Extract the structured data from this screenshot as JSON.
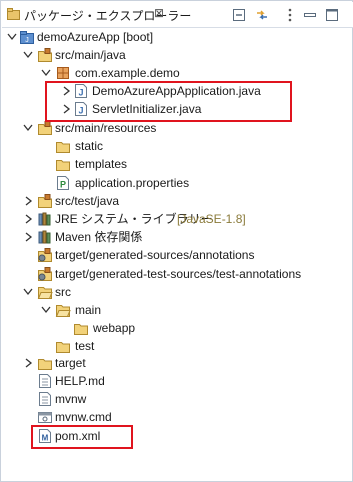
{
  "view": {
    "title": "パッケージ・エクスプローラー",
    "close_glyph": "⊠"
  },
  "tree": [
    {
      "label": "demoAzureApp [boot]"
    },
    {
      "label": "src/main/java"
    },
    {
      "label": "com.example.demo"
    },
    {
      "label": "DemoAzureAppApplication.java"
    },
    {
      "label": "ServletInitializer.java"
    },
    {
      "label": "src/main/resources"
    },
    {
      "label": "static"
    },
    {
      "label": "templates"
    },
    {
      "label": "application.properties"
    },
    {
      "label": "src/test/java"
    },
    {
      "label": "JRE システム・ライブラリー",
      "decoration": "[JavaSE-1.8]"
    },
    {
      "label": "Maven 依存関係"
    },
    {
      "label": "target/generated-sources/annotations"
    },
    {
      "label": "target/generated-test-sources/test-annotations"
    },
    {
      "label": "src"
    },
    {
      "label": "main"
    },
    {
      "label": "webapp"
    },
    {
      "label": "test"
    },
    {
      "label": "target"
    },
    {
      "label": "HELP.md"
    },
    {
      "label": "mvnw"
    },
    {
      "label": "mvnw.cmd"
    },
    {
      "label": "pom.xml"
    }
  ],
  "colors": {
    "highlight": "#e0141e",
    "folder": "#e8c567",
    "package": "#c77a2e",
    "java": "#3c6fb0"
  }
}
